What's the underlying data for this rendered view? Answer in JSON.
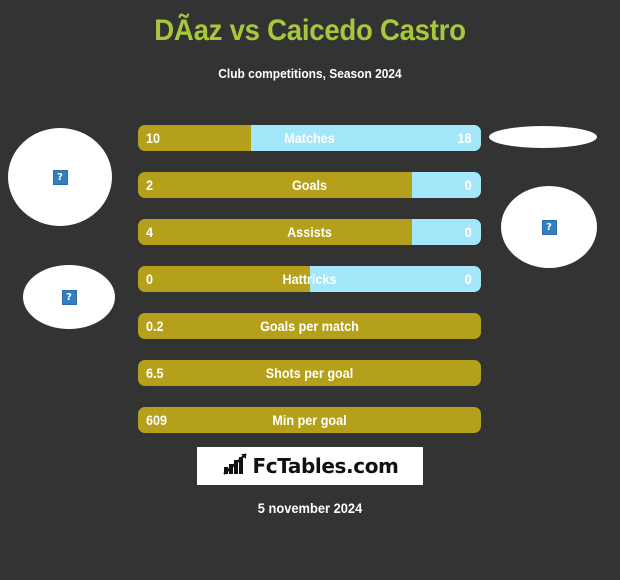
{
  "header": {
    "title": "DÃaz vs Caicedo Castro",
    "subtitle": "Club competitions, Season 2024",
    "title_color": "#a8c83c"
  },
  "colors": {
    "background": "#333333",
    "player1": "#b5a01b",
    "player2": "#a5e7fa",
    "text": "#ffffff"
  },
  "placeholders": {
    "glyph": "?",
    "p1_image_a": "broken-image-icon",
    "p1_image_b": "broken-image-icon",
    "p2_image_a": "broken-image-icon",
    "p2_image_b": "broken-image-icon"
  },
  "chart_data": {
    "type": "bar",
    "title": "DÃaz vs Caicedo Castro",
    "subtitle": "Club competitions, Season 2024",
    "orientation": "horizontal-diverging",
    "series": [
      {
        "name": "player1",
        "color": "#b5a01b"
      },
      {
        "name": "player2",
        "color": "#a5e7fa"
      }
    ],
    "categories": [
      "Matches",
      "Goals",
      "Assists",
      "Hattricks",
      "Goals per match",
      "Shots per goal",
      "Min per goal"
    ],
    "rows": [
      {
        "label": "Matches",
        "left": "10",
        "right": "18",
        "left_pct": 33,
        "two_sided": true
      },
      {
        "label": "Goals",
        "left": "2",
        "right": "0",
        "left_pct": 80,
        "two_sided": true
      },
      {
        "label": "Assists",
        "left": "4",
        "right": "0",
        "left_pct": 80,
        "two_sided": true
      },
      {
        "label": "Hattricks",
        "left": "0",
        "right": "0",
        "left_pct": 50,
        "two_sided": true
      },
      {
        "label": "Goals per match",
        "left": "0.2",
        "right": "",
        "left_pct": 100,
        "two_sided": false
      },
      {
        "label": "Shots per goal",
        "left": "6.5",
        "right": "",
        "left_pct": 100,
        "two_sided": false
      },
      {
        "label": "Min per goal",
        "left": "609",
        "right": "",
        "left_pct": 100,
        "two_sided": false
      }
    ]
  },
  "footer": {
    "logo_text": "FcTables.com",
    "logo_icon": "bar-chart-icon",
    "date": "5 november 2024"
  }
}
